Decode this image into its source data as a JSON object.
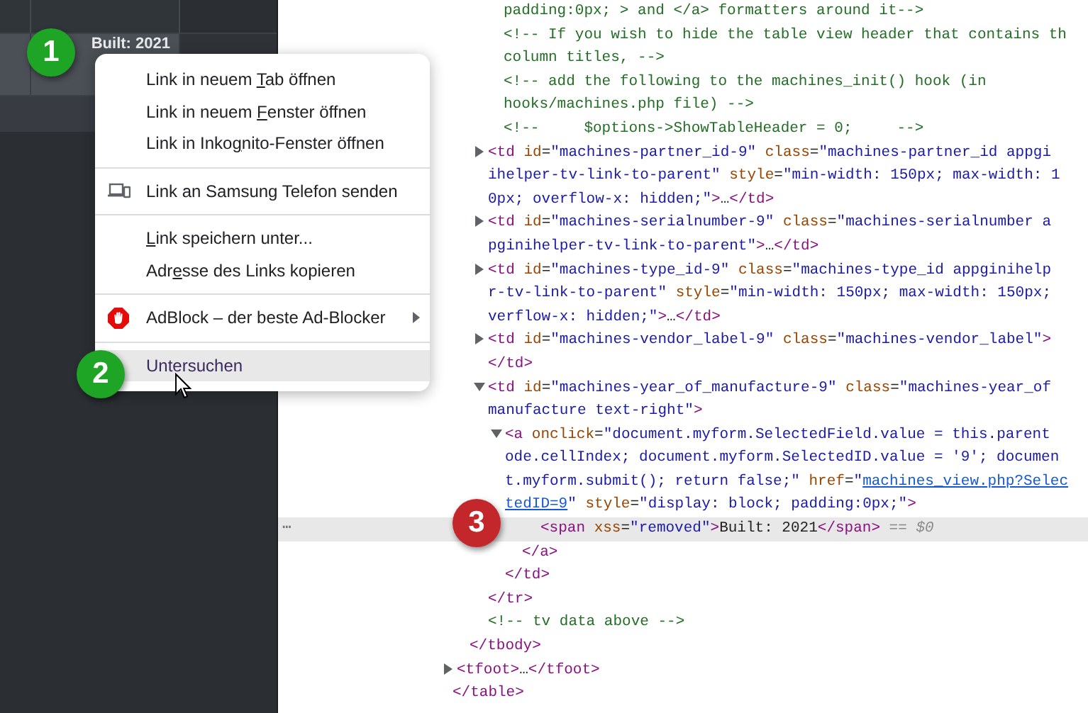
{
  "page": {
    "cell_text": "Built: 2021"
  },
  "devtools": {
    "lines": [
      {
        "selected": false,
        "segments": [
          {
            "kind": "comment",
            "text": "padding:0px; > and </a> formatters around it-->"
          }
        ]
      },
      {
        "selected": false,
        "segments": [
          {
            "kind": "comment",
            "text": "<!-- If you wish to hide the table view header that contains th"
          }
        ]
      },
      {
        "selected": false,
        "segments": [
          {
            "kind": "comment",
            "text": "column titles, -->"
          }
        ]
      },
      {
        "selected": false,
        "segments": [
          {
            "kind": "comment",
            "text": "<!-- add the following to the machines_init() hook (in"
          }
        ]
      },
      {
        "selected": false,
        "segments": [
          {
            "kind": "comment",
            "text": "hooks/machines.php file) -->"
          }
        ]
      },
      {
        "selected": false,
        "segments": [
          {
            "kind": "comment",
            "text": "<!--     $options->ShowTableHeader = 0;     -->"
          }
        ]
      },
      {
        "selected": false,
        "expanded": false,
        "segments": [
          {
            "kind": "tag",
            "text": "<td"
          },
          {
            "kind": "attr",
            "text": " id"
          },
          {
            "kind": "text",
            "text": "="
          },
          {
            "kind": "val",
            "text": "\"machines-partner_id-9\""
          },
          {
            "kind": "attr",
            "text": " class"
          },
          {
            "kind": "text",
            "text": "="
          },
          {
            "kind": "val",
            "text": "\"machines-partner_id appgi"
          }
        ]
      },
      {
        "selected": false,
        "segments": [
          {
            "kind": "val",
            "text": "ihelper-tv-link-to-parent\""
          },
          {
            "kind": "attr",
            "text": " style"
          },
          {
            "kind": "text",
            "text": "="
          },
          {
            "kind": "val",
            "text": "\"min-width: 150px; max-width: 1"
          }
        ]
      },
      {
        "selected": false,
        "segments": [
          {
            "kind": "val",
            "text": "0px; overflow-x: hidden;\""
          },
          {
            "kind": "tag",
            "text": ">"
          },
          {
            "kind": "text",
            "text": "…"
          },
          {
            "kind": "tag",
            "text": "</td>"
          }
        ]
      },
      {
        "selected": false,
        "expanded": false,
        "segments": [
          {
            "kind": "tag",
            "text": "<td"
          },
          {
            "kind": "attr",
            "text": " id"
          },
          {
            "kind": "text",
            "text": "="
          },
          {
            "kind": "val",
            "text": "\"machines-serialnumber-9\""
          },
          {
            "kind": "attr",
            "text": " class"
          },
          {
            "kind": "text",
            "text": "="
          },
          {
            "kind": "val",
            "text": "\"machines-serialnumber a"
          }
        ]
      },
      {
        "selected": false,
        "segments": [
          {
            "kind": "val",
            "text": "pginihelper-tv-link-to-parent\""
          },
          {
            "kind": "tag",
            "text": ">"
          },
          {
            "kind": "text",
            "text": "…"
          },
          {
            "kind": "tag",
            "text": "</td>"
          }
        ]
      },
      {
        "selected": false,
        "expanded": false,
        "segments": [
          {
            "kind": "tag",
            "text": "<td"
          },
          {
            "kind": "attr",
            "text": " id"
          },
          {
            "kind": "text",
            "text": "="
          },
          {
            "kind": "val",
            "text": "\"machines-type_id-9\""
          },
          {
            "kind": "attr",
            "text": " class"
          },
          {
            "kind": "text",
            "text": "="
          },
          {
            "kind": "val",
            "text": "\"machines-type_id appginihelp"
          }
        ]
      },
      {
        "selected": false,
        "segments": [
          {
            "kind": "val",
            "text": "r-tv-link-to-parent\""
          },
          {
            "kind": "attr",
            "text": " style"
          },
          {
            "kind": "text",
            "text": "="
          },
          {
            "kind": "val",
            "text": "\"min-width: 150px; max-width: 150px;"
          }
        ]
      },
      {
        "selected": false,
        "segments": [
          {
            "kind": "val",
            "text": "verflow-x: hidden;\""
          },
          {
            "kind": "tag",
            "text": ">"
          },
          {
            "kind": "text",
            "text": "…"
          },
          {
            "kind": "tag",
            "text": "</td>"
          }
        ]
      },
      {
        "selected": false,
        "expanded": false,
        "segments": [
          {
            "kind": "tag",
            "text": "<td"
          },
          {
            "kind": "attr",
            "text": " id"
          },
          {
            "kind": "text",
            "text": "="
          },
          {
            "kind": "val",
            "text": "\"machines-vendor_label-9\""
          },
          {
            "kind": "attr",
            "text": " class"
          },
          {
            "kind": "text",
            "text": "="
          },
          {
            "kind": "val",
            "text": "\"machines-vendor_label\""
          },
          {
            "kind": "tag",
            "text": ">"
          }
        ]
      },
      {
        "selected": false,
        "segments": [
          {
            "kind": "tag",
            "text": "</td>"
          }
        ]
      },
      {
        "selected": false,
        "expanded": true,
        "segments": [
          {
            "kind": "tag",
            "text": "<td"
          },
          {
            "kind": "attr",
            "text": " id"
          },
          {
            "kind": "text",
            "text": "="
          },
          {
            "kind": "val",
            "text": "\"machines-year_of_manufacture-9\""
          },
          {
            "kind": "attr",
            "text": " class"
          },
          {
            "kind": "text",
            "text": "="
          },
          {
            "kind": "val",
            "text": "\"machines-year_of"
          }
        ]
      },
      {
        "selected": false,
        "segments": [
          {
            "kind": "val",
            "text": "manufacture text-right\""
          },
          {
            "kind": "tag",
            "text": ">"
          }
        ]
      },
      {
        "selected": false,
        "expanded": true,
        "segments": [
          {
            "kind": "tag",
            "text": "<a"
          },
          {
            "kind": "attr",
            "text": " onclick"
          },
          {
            "kind": "text",
            "text": "="
          },
          {
            "kind": "val",
            "text": "\"document.myform.SelectedField.value = this.parent"
          }
        ]
      },
      {
        "selected": false,
        "segments": [
          {
            "kind": "val",
            "text": "ode.cellIndex; document.myform.SelectedID.value = '9'; documen"
          }
        ]
      },
      {
        "selected": false,
        "segments": [
          {
            "kind": "val",
            "text": "t.myform.submit(); return false;\""
          },
          {
            "kind": "attr",
            "text": " href"
          },
          {
            "kind": "text",
            "text": "="
          },
          {
            "kind": "val",
            "text": "\""
          },
          {
            "kind": "link",
            "text": "machines_view.php?Selec"
          }
        ]
      },
      {
        "selected": false,
        "segments": [
          {
            "kind": "link",
            "text": "tedID=9"
          },
          {
            "kind": "val",
            "text": "\""
          },
          {
            "kind": "attr",
            "text": " style"
          },
          {
            "kind": "text",
            "text": "="
          },
          {
            "kind": "val",
            "text": "\"display: block; padding:0px;\""
          },
          {
            "kind": "tag",
            "text": ">"
          }
        ]
      },
      {
        "selected": true,
        "gutter": "⋯",
        "segments": [
          {
            "kind": "tag",
            "text": "<span"
          },
          {
            "kind": "attr",
            "text": " xss"
          },
          {
            "kind": "text",
            "text": "="
          },
          {
            "kind": "val",
            "text": "\"removed\""
          },
          {
            "kind": "tag",
            "text": ">"
          },
          {
            "kind": "text",
            "text": "Built: 2021"
          },
          {
            "kind": "tag",
            "text": "</span>"
          },
          {
            "kind": "console",
            "text": " == $0"
          }
        ]
      },
      {
        "selected": false,
        "segments": [
          {
            "kind": "tag",
            "text": "</a>"
          }
        ]
      },
      {
        "selected": false,
        "segments": [
          {
            "kind": "tag",
            "text": "</td>"
          }
        ]
      },
      {
        "selected": false,
        "segments": [
          {
            "kind": "tag",
            "text": "</tr>"
          }
        ]
      },
      {
        "selected": false,
        "segments": [
          {
            "kind": "comment",
            "text": "<!-- tv data above -->"
          }
        ]
      },
      {
        "selected": false,
        "segments": [
          {
            "kind": "tag",
            "text": "</tbody>"
          }
        ]
      },
      {
        "selected": false,
        "expanded": false,
        "segments": [
          {
            "kind": "tag",
            "text": "<tfoot>"
          },
          {
            "kind": "text",
            "text": "…"
          },
          {
            "kind": "tag",
            "text": "</tfoot>"
          }
        ]
      },
      {
        "selected": false,
        "segments": [
          {
            "kind": "tag",
            "text": "</table>"
          }
        ]
      }
    ]
  },
  "context_menu": {
    "items": [
      {
        "kind": "entry",
        "selected": false,
        "label_parts": [
          {
            "kind": "plain",
            "text": "Link in neuem "
          },
          {
            "kind": "mnemonic",
            "text": "T"
          },
          {
            "kind": "plain",
            "text": "ab öffnen"
          }
        ]
      },
      {
        "kind": "entry",
        "selected": false,
        "label_parts": [
          {
            "kind": "plain",
            "text": "Link in neuem "
          },
          {
            "kind": "mnemonic",
            "text": "F"
          },
          {
            "kind": "plain",
            "text": "enster öffnen"
          }
        ]
      },
      {
        "kind": "entry",
        "selected": false,
        "label_parts": [
          {
            "kind": "plain",
            "text": "Link in Inko"
          },
          {
            "kind": "mnemonic",
            "text": "g"
          },
          {
            "kind": "plain",
            "text": "nito-Fenster öffnen"
          }
        ]
      },
      {
        "kind": "separator"
      },
      {
        "kind": "send",
        "selected": false,
        "label_parts": [
          {
            "kind": "plain",
            "text": "Link an Samsung Telefon senden"
          }
        ]
      },
      {
        "kind": "separator"
      },
      {
        "kind": "entry",
        "selected": false,
        "label_parts": [
          {
            "kind": "mnemonic",
            "text": "L"
          },
          {
            "kind": "plain",
            "text": "ink speichern unter..."
          }
        ]
      },
      {
        "kind": "entry",
        "selected": false,
        "label_parts": [
          {
            "kind": "plain",
            "text": "Adr"
          },
          {
            "kind": "mnemonic",
            "text": "e"
          },
          {
            "kind": "plain",
            "text": "sse des Links kopieren"
          }
        ]
      },
      {
        "kind": "separator"
      },
      {
        "kind": "extension",
        "selected": false,
        "submenu": true,
        "label_parts": [
          {
            "kind": "plain",
            "text": "AdBlock – der beste Ad-Blocker"
          }
        ]
      },
      {
        "kind": "separator"
      },
      {
        "kind": "entry",
        "selected": true,
        "label_parts": [
          {
            "kind": "plain",
            "text": "Untersuchen"
          }
        ]
      }
    ]
  },
  "step_badges": [
    {
      "text": "1",
      "color": "#1fa526"
    },
    {
      "text": "2",
      "color": "#1fa526"
    },
    {
      "text": "3",
      "color": "#c3262b"
    }
  ]
}
